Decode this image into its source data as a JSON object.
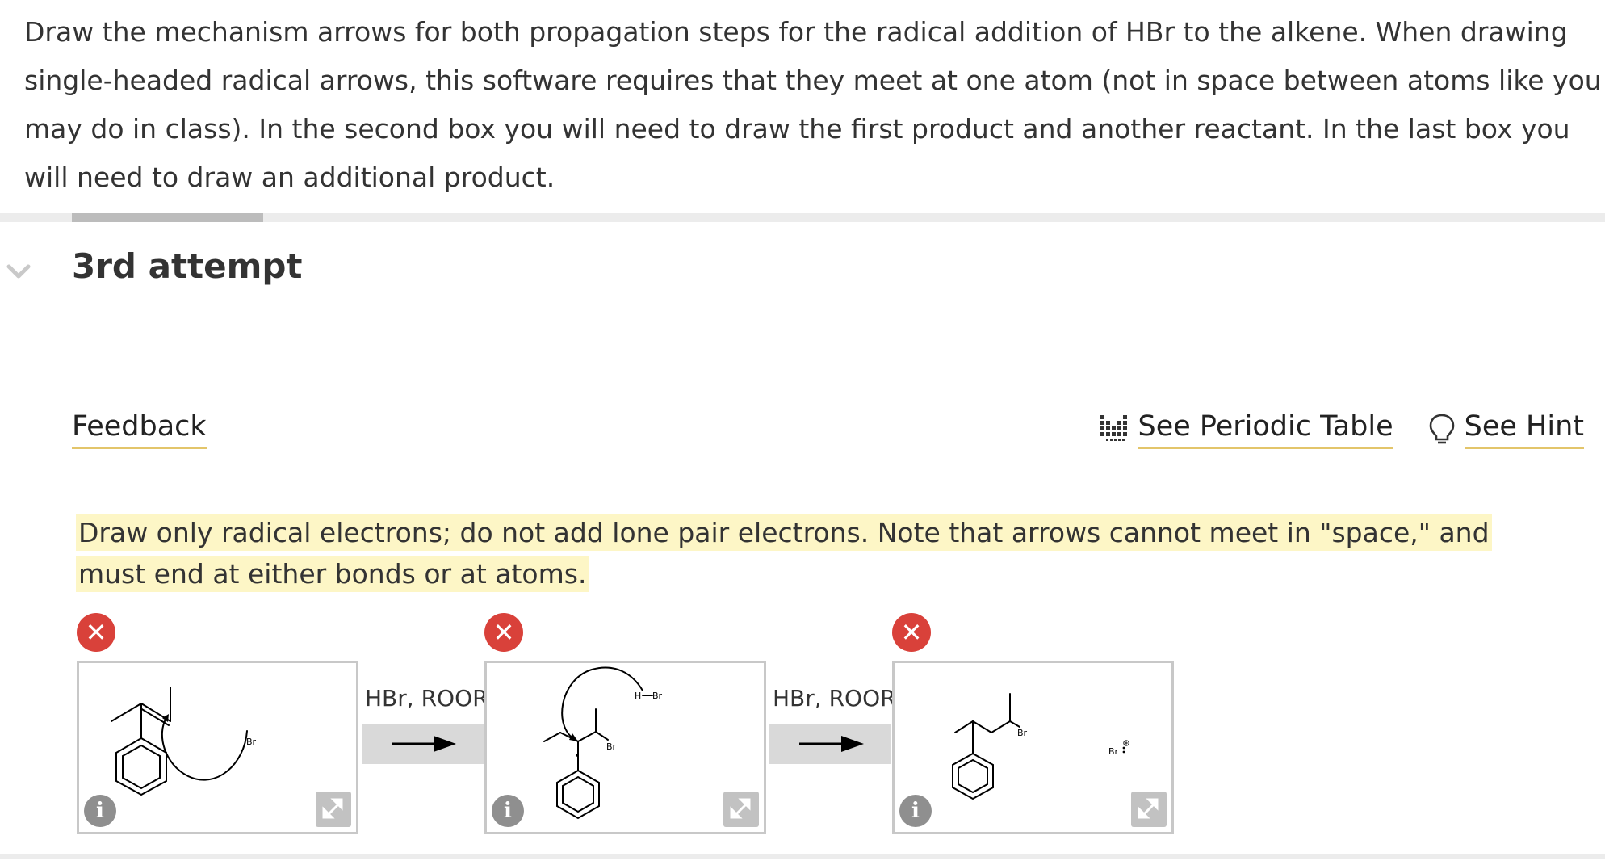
{
  "question": {
    "text": "Draw the mechanism arrows for both propagation steps for the radical addition of HBr to the alkene. When drawing single-headed radical arrows, this software requires that they meet at one atom (not in space between atoms like you may do in class). In the second box you will need to draw the first product and another reactant. In the last box you will need to draw an additional product."
  },
  "attempt": {
    "title": "3rd attempt"
  },
  "feedback": {
    "label": "Feedback"
  },
  "links": {
    "periodic_table": "See Periodic Table",
    "hint": "See Hint"
  },
  "note": {
    "text": "Draw only radical electrons; do not add lone pair electrons. Note that arrows cannot meet in \"space,\" and must end at either bonds or at atoms."
  },
  "scheme": {
    "status_icon": "x-icon",
    "status_color": "#d9413a",
    "arrow1_reagents": "HBr, ROOR",
    "arrow2_reagents": "HBr, ROOR",
    "panel1": {
      "atom_br": "Br"
    },
    "panel2": {
      "atom_h": "H",
      "atom_br_reagent": "Br",
      "atom_br": "Br"
    },
    "panel3": {
      "atom_br": "Br",
      "radical_label": "Br"
    }
  }
}
